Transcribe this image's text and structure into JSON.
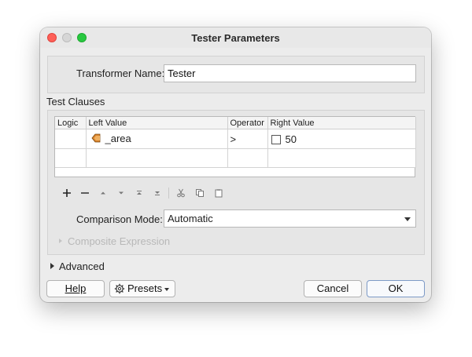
{
  "window": {
    "title": "Tester Parameters"
  },
  "transformer": {
    "label": "Transformer Name:",
    "value": "Tester"
  },
  "test_clauses": {
    "label": "Test Clauses",
    "columns": [
      "Logic",
      "Left Value",
      "Operator",
      "Right Value"
    ],
    "rows": [
      {
        "logic": "",
        "left_value": "_area",
        "operator": ">",
        "right_value": "50"
      }
    ],
    "toolbar_icons": [
      "plus-icon",
      "minus-icon",
      "move-up-icon",
      "move-down-icon",
      "move-top-icon",
      "move-bottom-icon",
      "cut-icon",
      "copy-icon",
      "paste-icon"
    ]
  },
  "comparison": {
    "label": "Comparison Mode:",
    "value": "Automatic"
  },
  "composite": {
    "label": "Composite Expression"
  },
  "advanced": {
    "label": "Advanced"
  },
  "buttons": {
    "help": "Help",
    "presets": "Presets",
    "cancel": "Cancel",
    "ok": "OK"
  },
  "colors": {
    "attribute_icon": "#d9822b",
    "ok_border": "#7d9ac7",
    "close": "#fe5f57",
    "maximize": "#28c840"
  }
}
